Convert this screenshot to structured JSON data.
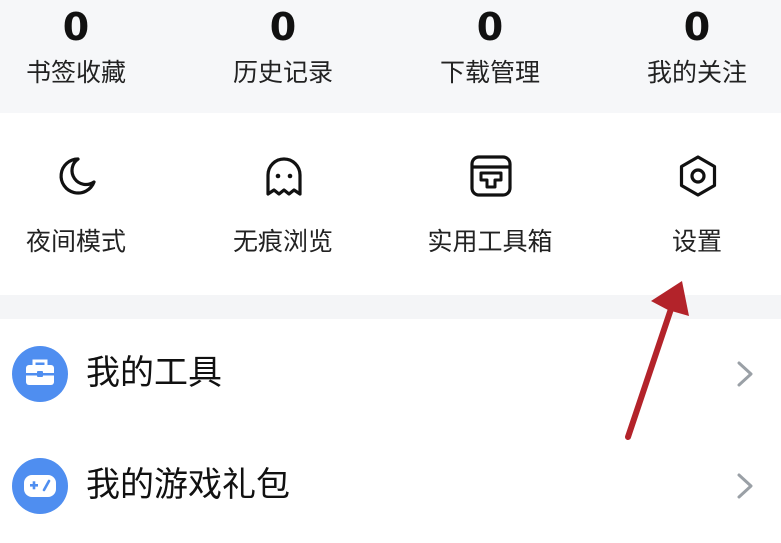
{
  "stats": [
    {
      "value": "0",
      "label": "书签收藏"
    },
    {
      "value": "0",
      "label": "历史记录"
    },
    {
      "value": "0",
      "label": "下载管理"
    },
    {
      "value": "0",
      "label": "我的关注"
    }
  ],
  "tools": [
    {
      "label": "夜间模式",
      "icon": "moon-icon"
    },
    {
      "label": "无痕浏览",
      "icon": "ghost-icon"
    },
    {
      "label": "实用工具箱",
      "icon": "toolbox-icon"
    },
    {
      "label": "设置",
      "icon": "settings-hexagon-icon"
    }
  ],
  "list": [
    {
      "label": "我的工具",
      "icon": "briefcase-icon"
    },
    {
      "label": "我的游戏礼包",
      "icon": "game-controller-icon"
    }
  ],
  "colors": {
    "accent": "#4f8ef0",
    "annotation_arrow": "#b3232a",
    "page_bg": "#f6f7f9",
    "card_bg": "#ffffff"
  }
}
